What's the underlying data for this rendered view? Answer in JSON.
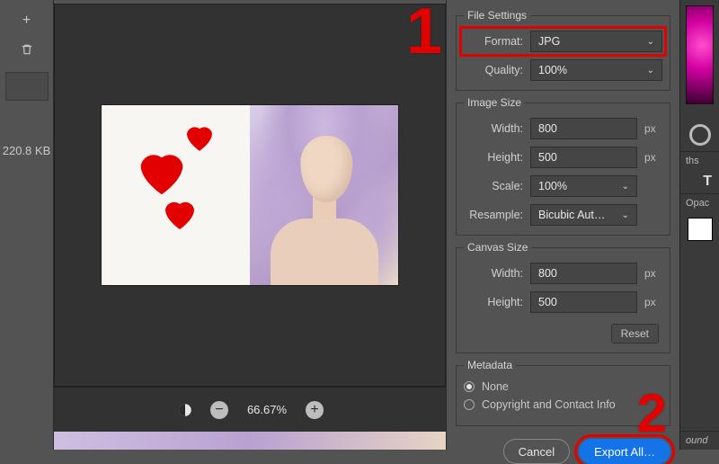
{
  "left": {
    "filesize": "220.8 KB"
  },
  "preview": {
    "zoom": "66.67%"
  },
  "sections": {
    "file_settings": "File Settings",
    "image_size": "Image Size",
    "canvas_size": "Canvas Size",
    "metadata": "Metadata"
  },
  "file_settings": {
    "format_label": "Format:",
    "format_value": "JPG",
    "quality_label": "Quality:",
    "quality_value": "100%"
  },
  "image_size": {
    "width_label": "Width:",
    "width_value": "800",
    "height_label": "Height:",
    "height_value": "500",
    "scale_label": "Scale:",
    "scale_value": "100%",
    "resample_label": "Resample:",
    "resample_value": "Bicubic Aut…",
    "unit": "px"
  },
  "canvas_size": {
    "width_label": "Width:",
    "width_value": "800",
    "height_label": "Height:",
    "height_value": "500",
    "unit": "px",
    "reset": "Reset"
  },
  "metadata": {
    "none": "None",
    "copyright": "Copyright and Contact Info"
  },
  "buttons": {
    "cancel": "Cancel",
    "export_all": "Export All…"
  },
  "bg_panels": {
    "paths": "ths",
    "opacity": "Opac",
    "sound": "ound"
  },
  "annotations": {
    "one": "1",
    "two": "2"
  }
}
